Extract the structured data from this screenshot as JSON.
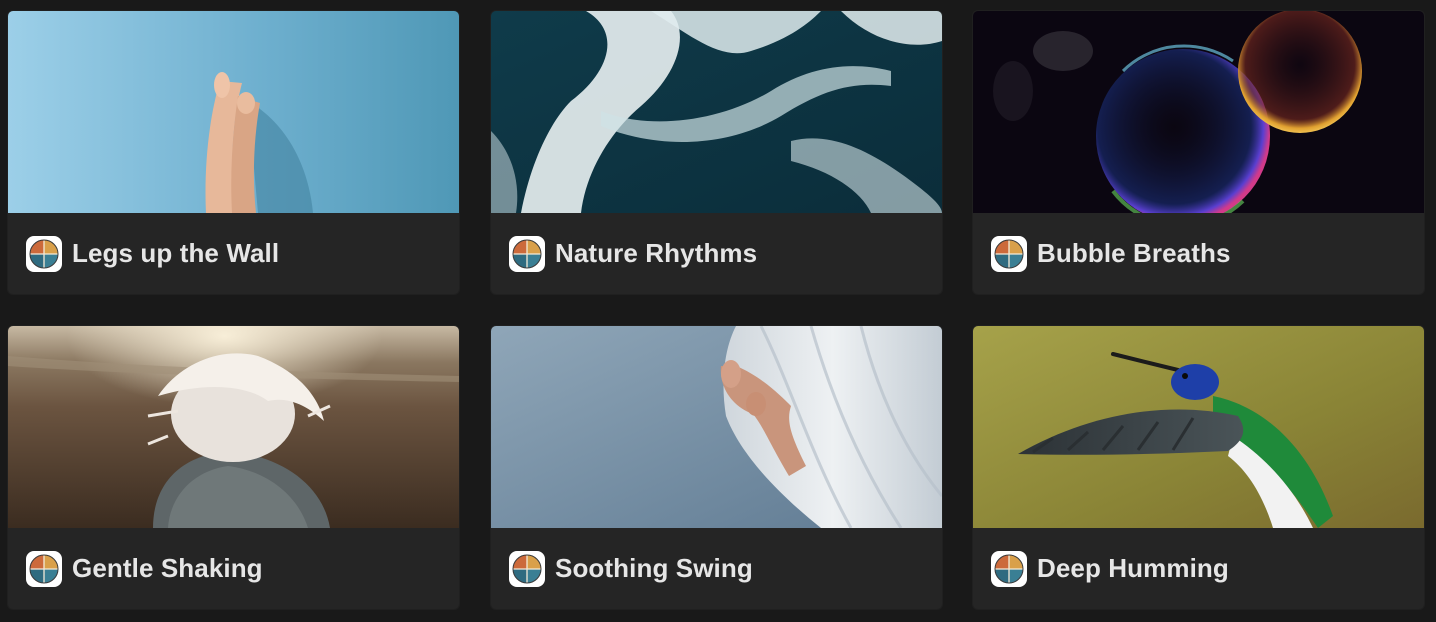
{
  "gallery": {
    "cards": [
      {
        "title": "Legs up the Wall",
        "icon": "meditation-circle-icon"
      },
      {
        "title": "Nature Rhythms",
        "icon": "meditation-circle-icon"
      },
      {
        "title": "Bubble Breaths",
        "icon": "meditation-circle-icon"
      },
      {
        "title": "Gentle Shaking",
        "icon": "meditation-circle-icon"
      },
      {
        "title": "Soothing Swing",
        "icon": "meditation-circle-icon"
      },
      {
        "title": "Deep Humming",
        "icon": "meditation-circle-icon"
      }
    ]
  },
  "colors": {
    "background": "#191919",
    "card": "#252525",
    "title_text": "#e6e6e6"
  }
}
